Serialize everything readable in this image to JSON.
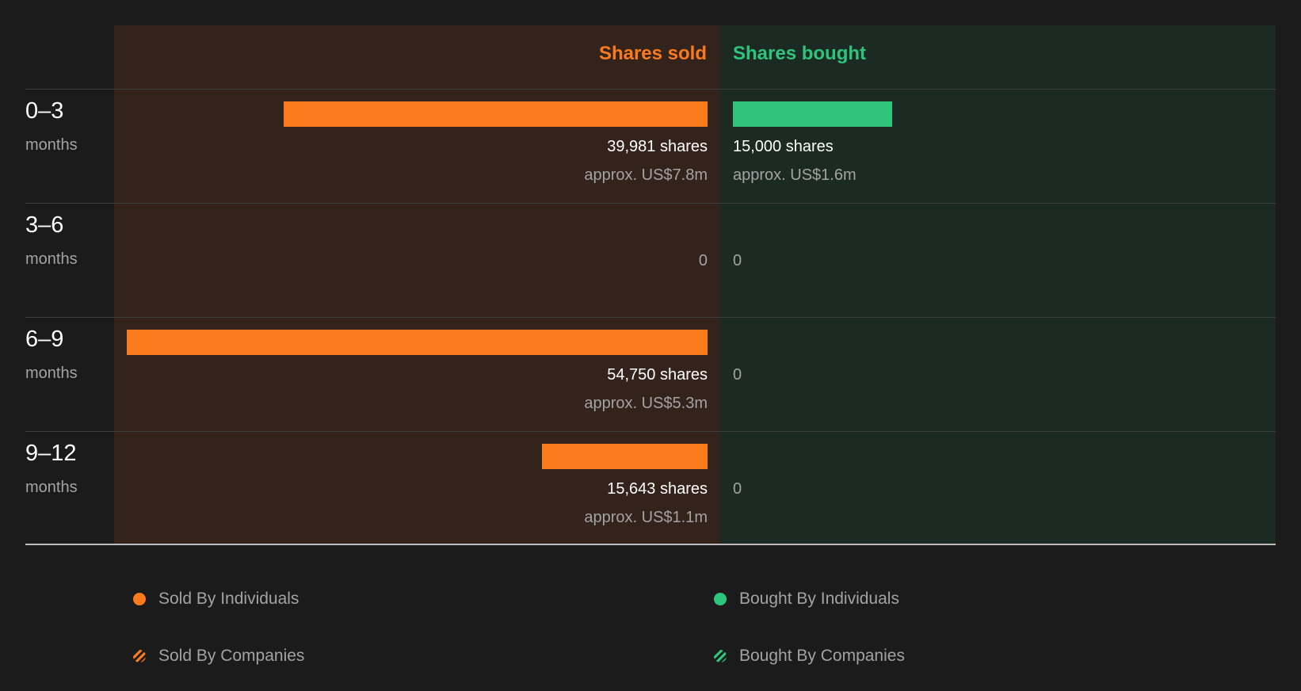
{
  "headers": {
    "sold": "Shares sold",
    "bought": "Shares bought"
  },
  "colors": {
    "sold": "#fb7a1c",
    "bought": "#2ec47b"
  },
  "chart_data": {
    "type": "bar",
    "categories": [
      "0–3 months",
      "3–6 months",
      "6–9 months",
      "9–12 months"
    ],
    "series": [
      {
        "name": "Shares sold",
        "values": [
          39981,
          0,
          54750,
          15643
        ]
      },
      {
        "name": "Shares bought",
        "values": [
          15000,
          0,
          0,
          0
        ]
      }
    ]
  },
  "rows": [
    {
      "range": "0–3",
      "unit": "months",
      "sold": {
        "shares": 39981,
        "label": "39,981 shares",
        "approx": "approx. US$7.8m",
        "zero": ""
      },
      "bought": {
        "shares": 15000,
        "label": "15,000 shares",
        "approx": "approx. US$1.6m",
        "zero": ""
      }
    },
    {
      "range": "3–6",
      "unit": "months",
      "sold": {
        "shares": 0,
        "label": "",
        "approx": "",
        "zero": "0"
      },
      "bought": {
        "shares": 0,
        "label": "",
        "approx": "",
        "zero": "0"
      }
    },
    {
      "range": "6–9",
      "unit": "months",
      "sold": {
        "shares": 54750,
        "label": "54,750 shares",
        "approx": "approx. US$5.3m",
        "zero": ""
      },
      "bought": {
        "shares": 0,
        "label": "",
        "approx": "",
        "zero": "0"
      }
    },
    {
      "range": "9–12",
      "unit": "months",
      "sold": {
        "shares": 15643,
        "label": "15,643 shares",
        "approx": "approx. US$1.1m",
        "zero": ""
      },
      "bought": {
        "shares": 0,
        "label": "",
        "approx": "",
        "zero": "0"
      }
    }
  ],
  "legend": {
    "sold_individuals": "Sold By Individuals",
    "bought_individuals": "Bought By Individuals",
    "sold_companies": "Sold By Companies",
    "bought_companies": "Bought By Companies"
  }
}
